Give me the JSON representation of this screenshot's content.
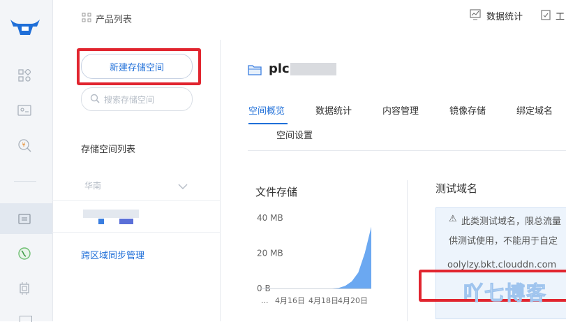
{
  "header": {
    "breadcrumb": "产品列表",
    "stats_label": "数据统计",
    "tools_label": "工"
  },
  "left": {
    "new_button": "新建存储空间",
    "search_placeholder": "搜索存储空间",
    "list_title": "存储空间列表",
    "region": "华南",
    "cross_region": "跨区域同步管理"
  },
  "bucket": {
    "name": "plc"
  },
  "tabs": [
    "空间概览",
    "数据统计",
    "内容管理",
    "镜像存储",
    "绑定域名",
    "空间设置"
  ],
  "storage": {
    "title": "文件存储"
  },
  "chart_data": {
    "type": "area",
    "title": "",
    "y_ticks": [
      "40 MB",
      "20 MB",
      "0 B"
    ],
    "x_ticks": [
      "...",
      "4月16日",
      "4月18日",
      "4月20日"
    ],
    "ylim": [
      0,
      40
    ],
    "x": [
      0,
      1,
      2,
      3,
      4,
      5,
      6,
      7,
      8,
      9,
      10,
      11,
      12
    ],
    "values": [
      0,
      0,
      0,
      0,
      0,
      0,
      0,
      0.3,
      1.5,
      4,
      9,
      20,
      35
    ],
    "color": "#5b9ef0"
  },
  "test_domain": {
    "title": "测试域名",
    "notice_line1": "此类测试域名，限总流量",
    "notice_line2": "供测试使用，不能用于自定",
    "domain": "oolylzy.bkt.clouddn.com"
  },
  "watermark": "吖七博客",
  "colors": {
    "accent": "#1f6fd8",
    "red_box": "#e1252f",
    "rail_bg": "#f3f5f8"
  }
}
